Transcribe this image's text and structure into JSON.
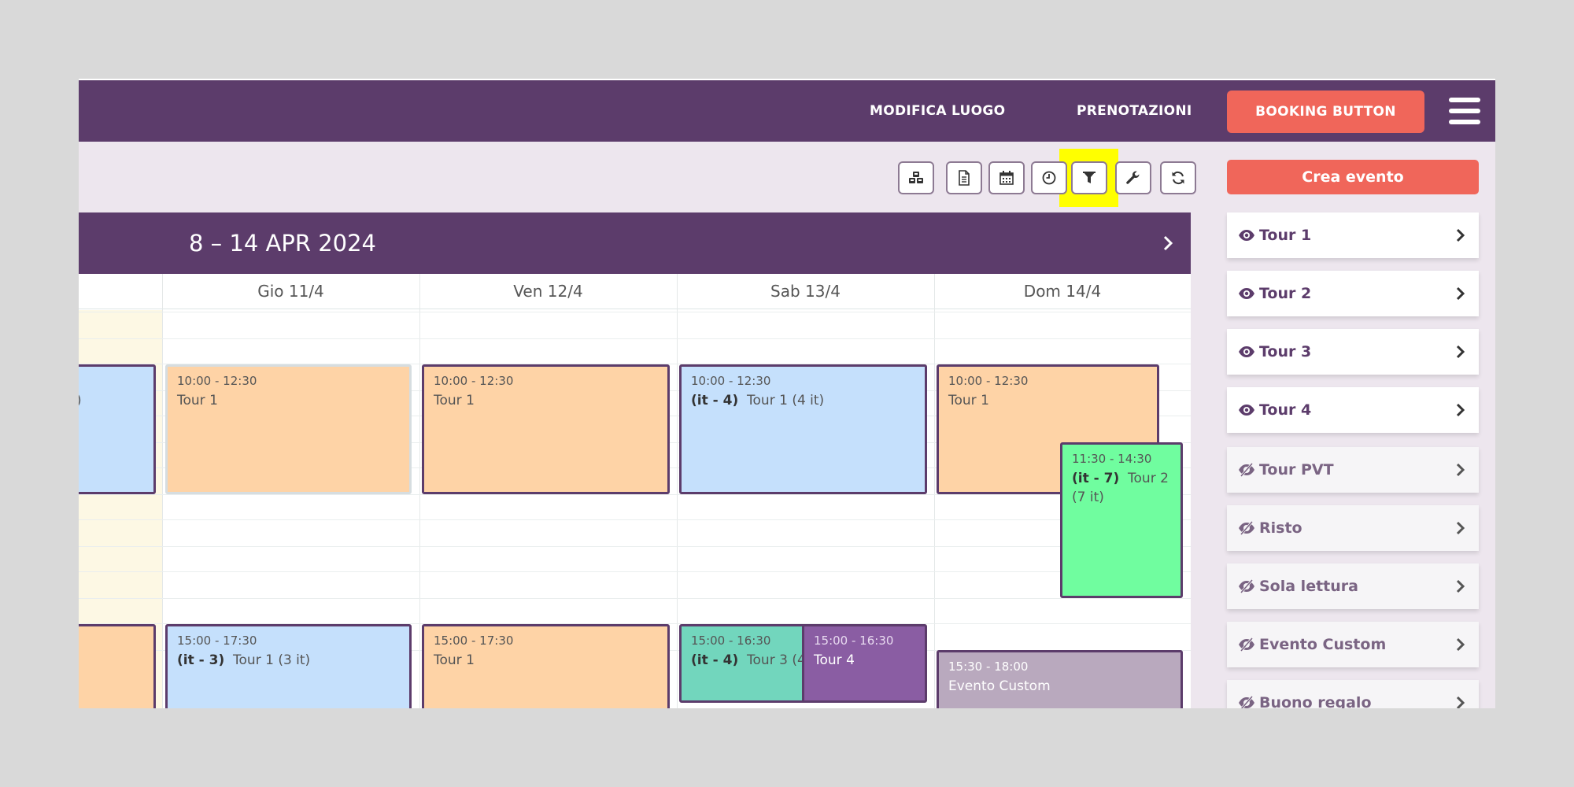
{
  "navbar": {
    "links": [
      "MODIFICA LUOGO",
      "PRENOTAZIONI"
    ],
    "booking_label": "BOOKING BUTTON",
    "brand_color": "#5c3c6b",
    "accent_color": "#f0665a"
  },
  "toolbar": {
    "buttons": [
      {
        "icon": "cubes-icon"
      },
      {
        "icon": "document-icon"
      },
      {
        "icon": "calendar-icon"
      },
      {
        "icon": "clock-icon"
      },
      {
        "icon": "filter-icon",
        "highlighted": true
      },
      {
        "icon": "wrench-icon"
      },
      {
        "icon": "refresh-icon"
      }
    ]
  },
  "calendar": {
    "title": "8 – 14 APR 2024",
    "columns": [
      "Gio 11/4",
      "Ven 12/4",
      "Sab 13/4",
      "Dom 14/4"
    ],
    "events": [
      {
        "time": "",
        "tag": "",
        "title": ")",
        "color": "blue"
      },
      {
        "time": "10:00 - 12:30",
        "tag": "",
        "title": "Tour 1",
        "color": "orange"
      },
      {
        "time": "10:00 - 12:30",
        "tag": "",
        "title": "Tour 1",
        "color": "orange"
      },
      {
        "time": "10:00 - 12:30",
        "tag": "(it - 4)",
        "title": "Tour 1  (4 it)",
        "color": "blue"
      },
      {
        "time": "10:00 - 12:30",
        "tag": "",
        "title": "Tour 1",
        "color": "orange"
      },
      {
        "time": "11:30 - 14:30",
        "tag": "(it - 7)",
        "title": "Tour 2  (7 it)",
        "color": "green"
      },
      {
        "time": "",
        "tag": "",
        "title": "",
        "color": "orange"
      },
      {
        "time": "15:00 - 17:30",
        "tag": "(it - 3)",
        "title": "Tour 1  (3 it)",
        "color": "blue"
      },
      {
        "time": "15:00 - 17:30",
        "tag": "",
        "title": "Tour 1",
        "color": "orange"
      },
      {
        "time": "15:00 - 16:30",
        "tag": "(it - 4)",
        "title": "Tour 3  (4",
        "color": "teal"
      },
      {
        "time": "15:00 - 16:30",
        "tag": "",
        "title": "Tour 4",
        "color": "purple"
      },
      {
        "time": "15:30 - 18:00",
        "tag": "",
        "title": "Evento Custom",
        "color": "mauve"
      }
    ]
  },
  "sidebar": {
    "create_label": "Crea evento",
    "items": [
      {
        "label": "Tour 1",
        "visible": true
      },
      {
        "label": "Tour 2",
        "visible": true
      },
      {
        "label": "Tour 3",
        "visible": true
      },
      {
        "label": "Tour 4",
        "visible": true
      },
      {
        "label": "Tour PVT",
        "visible": false
      },
      {
        "label": "Risto",
        "visible": false
      },
      {
        "label": "Sola lettura",
        "visible": false
      },
      {
        "label": "Evento Custom",
        "visible": false
      },
      {
        "label": "Buono regalo",
        "visible": false
      }
    ]
  }
}
